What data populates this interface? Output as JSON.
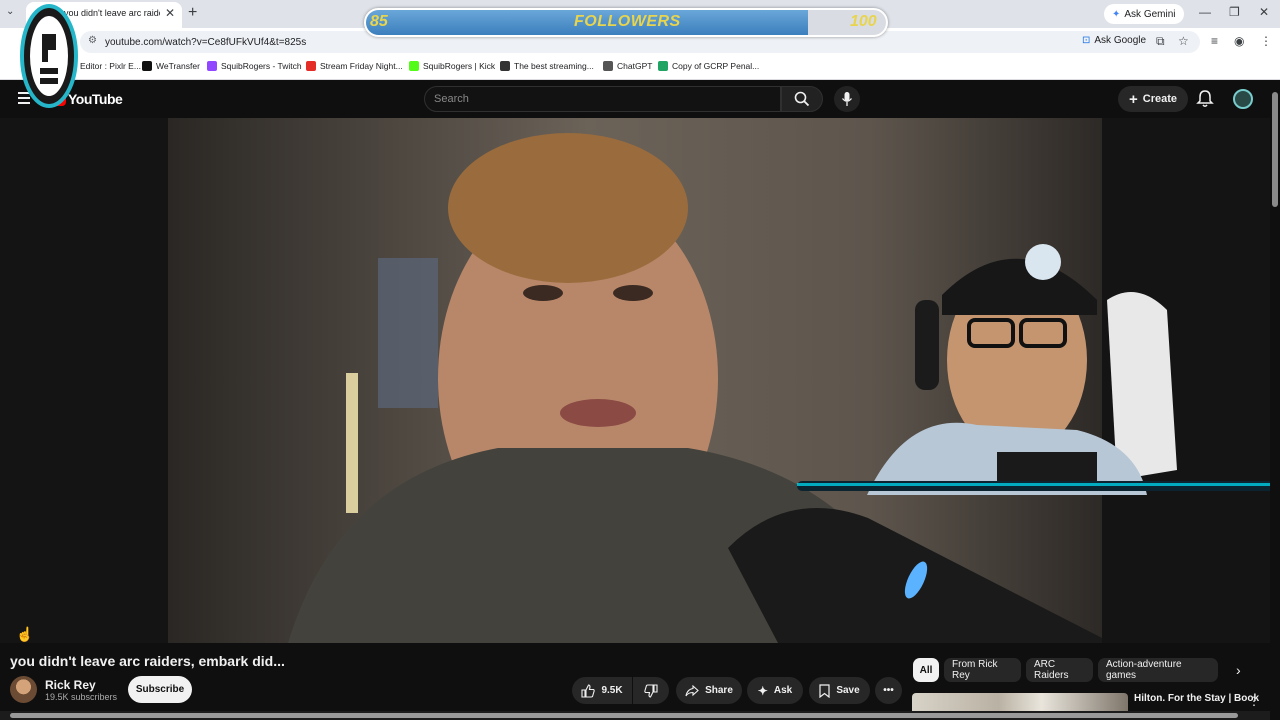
{
  "browser": {
    "tab_title": "you didn't leave arc raiders, embark did...",
    "tab_close": "✕",
    "new_tab": "+",
    "tab_list": "⌄",
    "ask_gemini": "Ask Gemini",
    "url": "youtube.com/watch?v=Ce8fUFkVUf4&t=825s",
    "ask_google": "Ask Google",
    "window_controls": [
      "—",
      "❐",
      "✕"
    ]
  },
  "bookmarks": [
    {
      "label": "Editor : Pixlr E...",
      "color": "#2d7be5"
    },
    {
      "label": "WeTransfer",
      "color": "#111111"
    },
    {
      "label": "SquibRogers - Twitch",
      "color": "#9146ff"
    },
    {
      "label": "Stream Friday Night...",
      "color": "#e52d27"
    },
    {
      "label": "SquibRogers | Kick",
      "color": "#53fc18"
    },
    {
      "label": "The best streaming...",
      "color": "#333333"
    },
    {
      "label": "ChatGPT",
      "color": "#555555"
    },
    {
      "label": "Copy of GCRP Penal...",
      "color": "#1fa463"
    }
  ],
  "followers": {
    "current": "85",
    "label": "FOLLOWERS",
    "goal": "100",
    "progress_fraction": 0.85
  },
  "youtube": {
    "logo_text": "YouTube",
    "search_placeholder": "Search",
    "create_label": "Create"
  },
  "video": {
    "title": "you didn't leave arc raiders, embark did...",
    "channel_name": "Rick Rey",
    "subscribers": "19.5K subscribers",
    "subscribe_label": "Subscribe",
    "likes": "9.5K",
    "share_label": "Share",
    "ask_label": "Ask",
    "save_label": "Save"
  },
  "chips": [
    "All",
    "From Rick Rey",
    "ARC Raiders",
    "Action-adventure games"
  ],
  "recommendation": {
    "title": "Hilton. For the Stay | Book"
  },
  "colors": {
    "accent_followers": "#e8d44d",
    "youtube_red": "#ff0000",
    "webcam_glow": "#00e5ff"
  }
}
